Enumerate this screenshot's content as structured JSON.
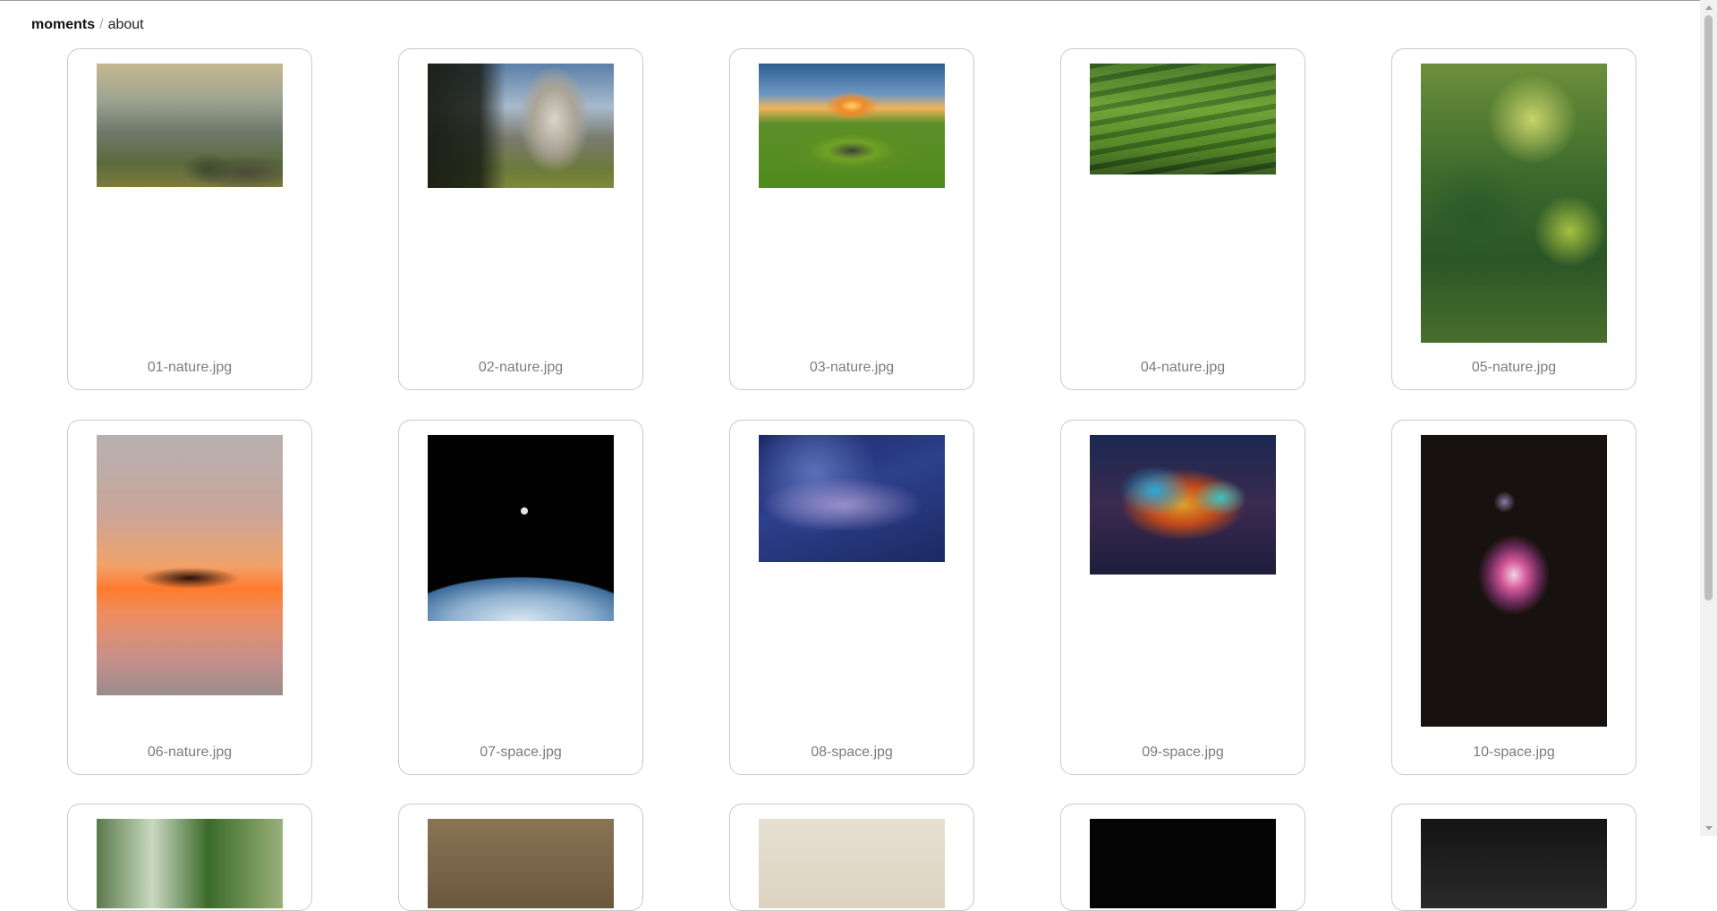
{
  "breadcrumb": {
    "home": "moments",
    "separator": "/",
    "current": "about"
  },
  "photos": [
    {
      "filename": "01-nature.jpg"
    },
    {
      "filename": "02-nature.jpg"
    },
    {
      "filename": "03-nature.jpg"
    },
    {
      "filename": "04-nature.jpg"
    },
    {
      "filename": "05-nature.jpg"
    },
    {
      "filename": "06-nature.jpg"
    },
    {
      "filename": "07-space.jpg"
    },
    {
      "filename": "08-space.jpg"
    },
    {
      "filename": "09-space.jpg"
    },
    {
      "filename": "10-space.jpg"
    },
    {
      "filename": ""
    },
    {
      "filename": ""
    },
    {
      "filename": ""
    },
    {
      "filename": ""
    },
    {
      "filename": ""
    }
  ]
}
